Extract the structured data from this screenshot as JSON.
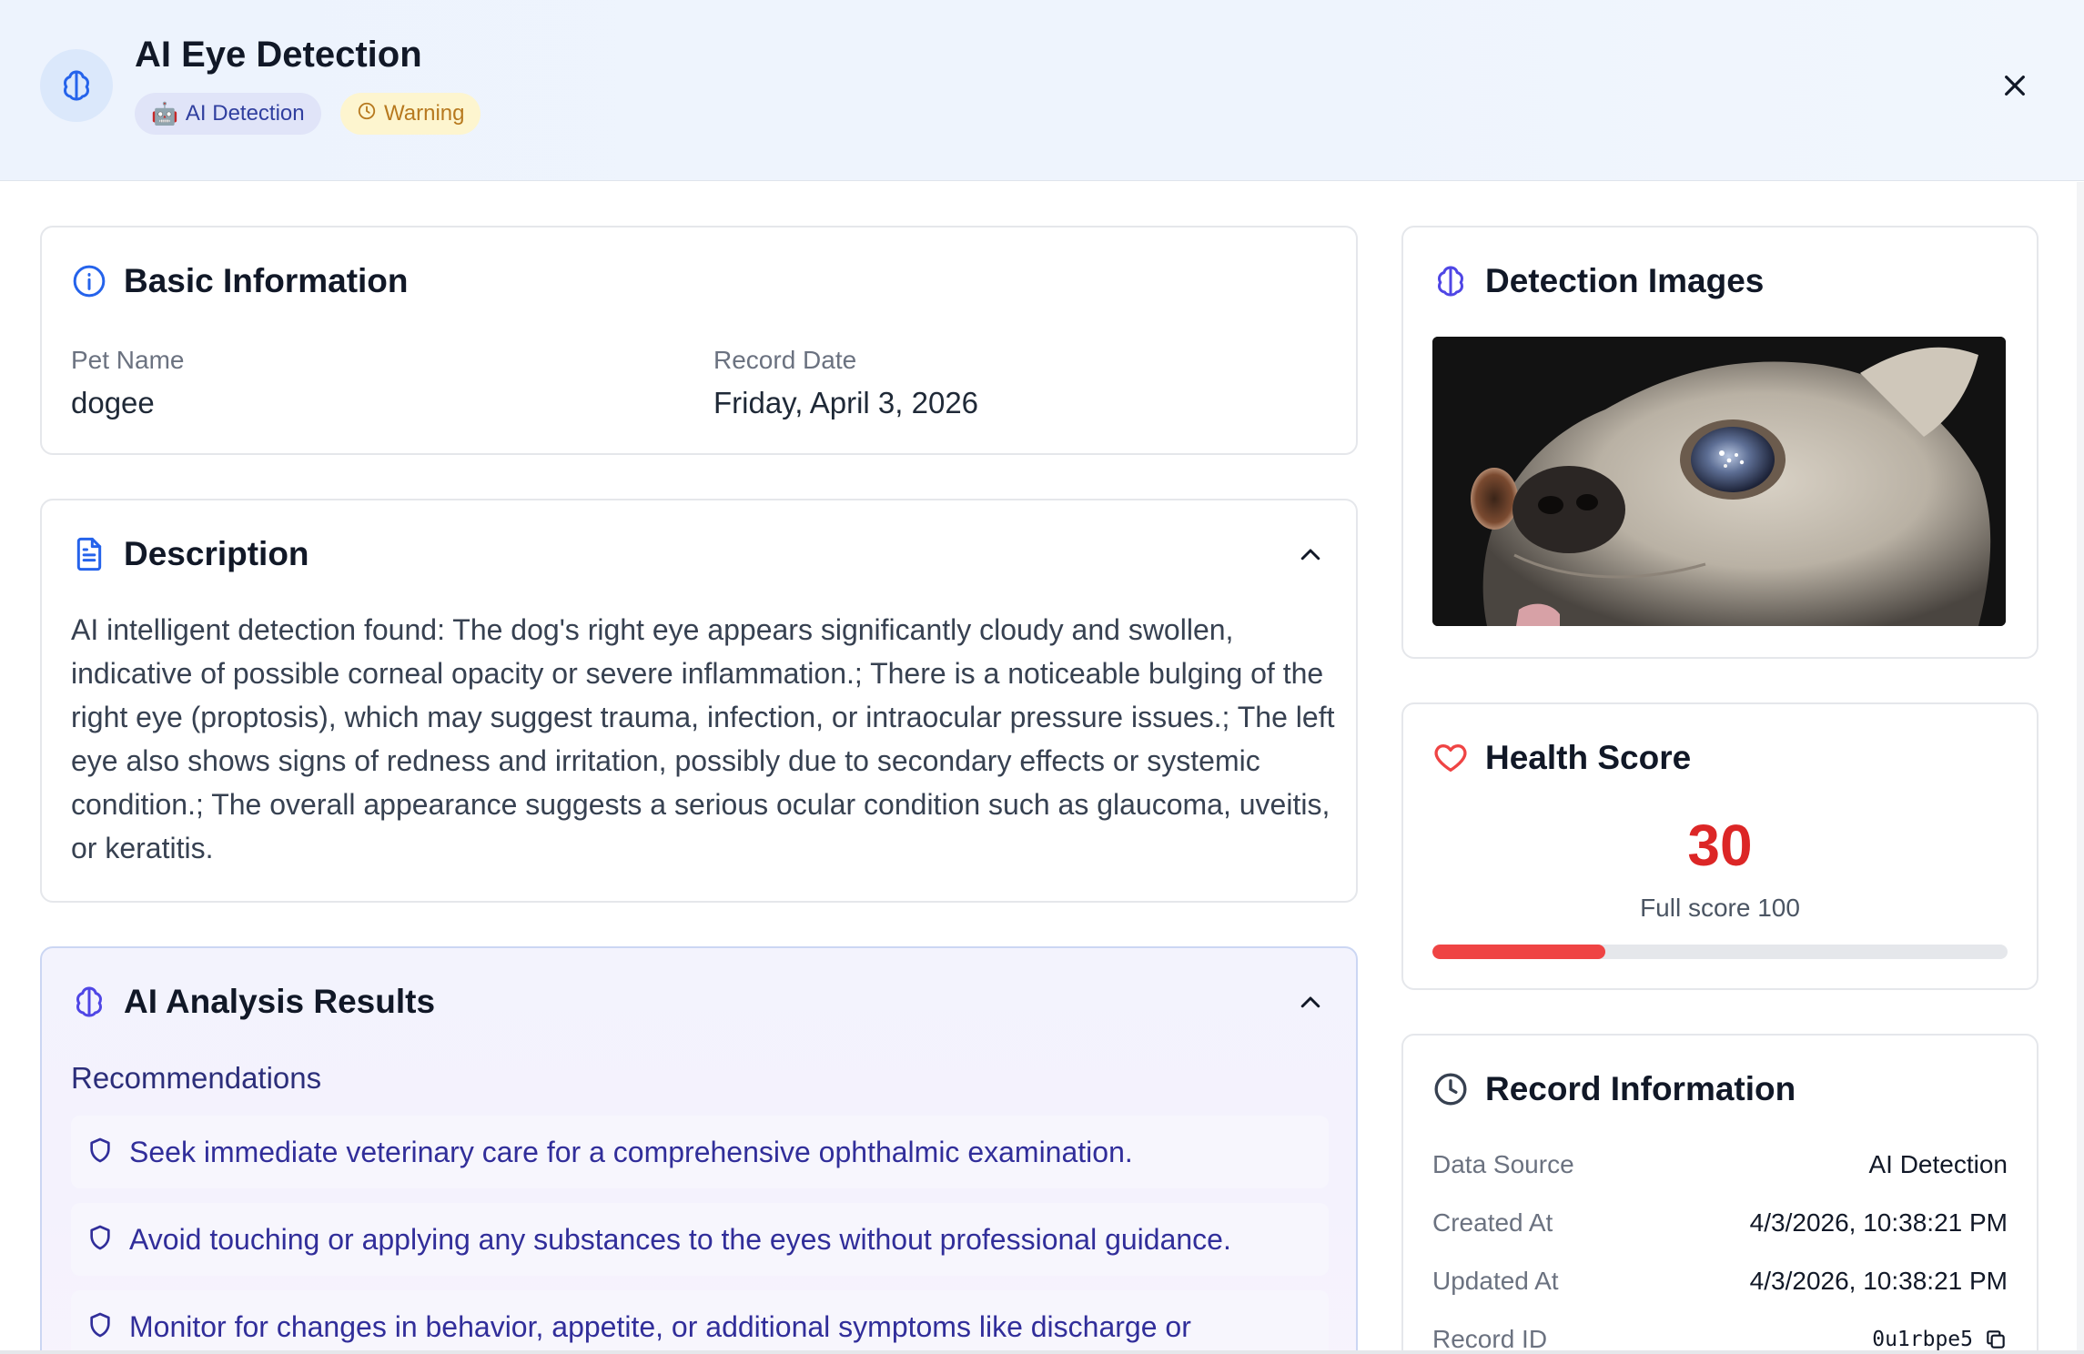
{
  "header": {
    "title": "AI Eye Detection",
    "badge_source": "AI Detection",
    "badge_source_emoji": "🤖",
    "badge_status": "Warning",
    "icons": {
      "main": "brain-icon",
      "close": "close-icon",
      "status": "clock-icon"
    }
  },
  "basic_info": {
    "title": "Basic Information",
    "pet_name_label": "Pet Name",
    "pet_name_value": "dogee",
    "record_date_label": "Record Date",
    "record_date_value": "Friday, April 3, 2026"
  },
  "description": {
    "title": "Description",
    "text": "AI intelligent detection found: The dog's right eye appears significantly cloudy and swollen, indicative of possible corneal opacity or severe inflammation.; There is a noticeable bulging of the right eye (proptosis), which may suggest trauma, infection, or intraocular pressure issues.; The left eye also shows signs of redness and irritation, possibly due to secondary effects or systemic condition.; The overall appearance suggests a serious ocular condition such as glaucoma, uveitis, or keratitis."
  },
  "ai_analysis": {
    "title": "AI Analysis Results",
    "recommendations_label": "Recommendations",
    "recommendations": [
      "Seek immediate veterinary care for a comprehensive ophthalmic examination.",
      "Avoid touching or applying any substances to the eyes without professional guidance.",
      "Monitor for changes in behavior, appetite, or additional symptoms like discharge or"
    ]
  },
  "detection_images": {
    "title": "Detection Images"
  },
  "health_score": {
    "title": "Health Score",
    "score": "30",
    "full_score_label": "Full score 100",
    "score_fraction": 0.3
  },
  "record_info": {
    "title": "Record Information",
    "rows": [
      {
        "label": "Data Source",
        "value": "AI Detection"
      },
      {
        "label": "Created At",
        "value": "4/3/2026, 10:38:21 PM"
      },
      {
        "label": "Updated At",
        "value": "4/3/2026, 10:38:21 PM"
      },
      {
        "label": "Record ID",
        "value": "0u1rbpe5"
      }
    ]
  },
  "colors": {
    "accent_blue": "#2563eb",
    "danger_red": "#dc2626",
    "warning_amber": "#b7791f",
    "indigo_text": "#312e9a"
  }
}
